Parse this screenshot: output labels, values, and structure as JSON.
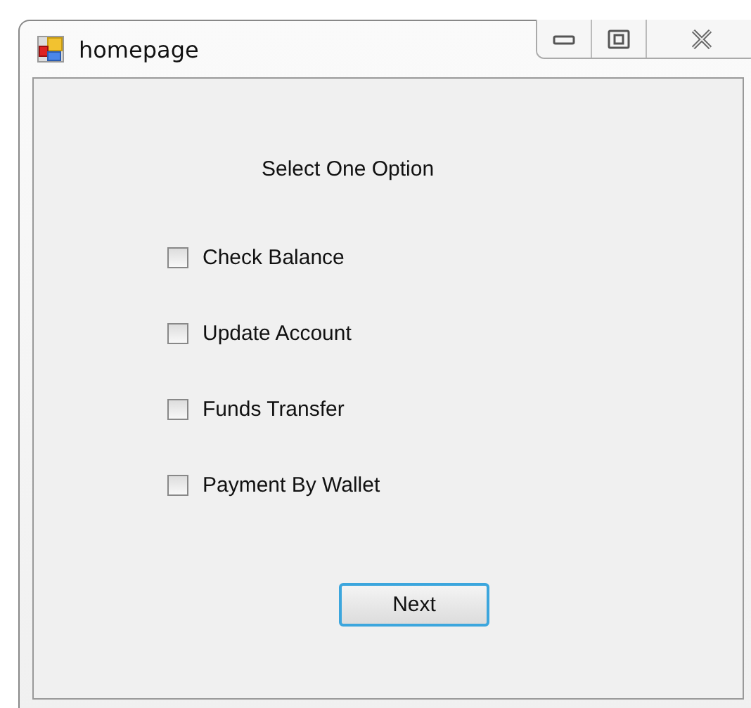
{
  "window": {
    "title": "homepage"
  },
  "prompt": "Select One Option",
  "options": [
    {
      "label": "Check Balance",
      "checked": false
    },
    {
      "label": "Update Account",
      "checked": false
    },
    {
      "label": "Funds Transfer",
      "checked": false
    },
    {
      "label": "Payment By Wallet",
      "checked": false
    }
  ],
  "buttons": [
    {
      "label": "Next"
    }
  ]
}
